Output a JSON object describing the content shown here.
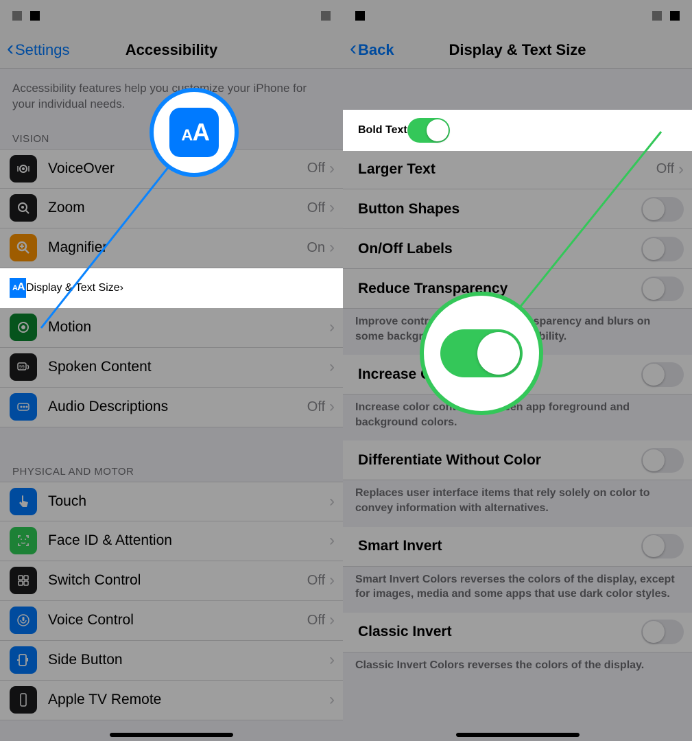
{
  "left": {
    "back": "Settings",
    "title": "Accessibility",
    "intro": "Accessibility features help you customize your iPhone for your individual needs.",
    "sections": {
      "vision_header": "VISION",
      "vision": [
        {
          "label": "VoiceOver",
          "value": "Off",
          "icon": "voiceover",
          "color": "ic-black"
        },
        {
          "label": "Zoom",
          "value": "Off",
          "icon": "zoom",
          "color": "ic-black"
        },
        {
          "label": "Magnifier",
          "value": "On",
          "icon": "magnifier",
          "color": "ic-orange"
        },
        {
          "label": "Display & Text Size",
          "value": "",
          "icon": "textsize",
          "color": "ic-blue",
          "highlight": true
        },
        {
          "label": "Motion",
          "value": "",
          "icon": "motion",
          "color": "ic-green"
        },
        {
          "label": "Spoken Content",
          "value": "",
          "icon": "spoken",
          "color": "ic-black"
        },
        {
          "label": "Audio Descriptions",
          "value": "Off",
          "icon": "audiodesc",
          "color": "ic-blue"
        }
      ],
      "physical_header": "PHYSICAL AND MOTOR",
      "physical": [
        {
          "label": "Touch",
          "value": "",
          "icon": "touch",
          "color": "ic-blue"
        },
        {
          "label": "Face ID & Attention",
          "value": "",
          "icon": "faceid",
          "color": "ic-lgreen"
        },
        {
          "label": "Switch Control",
          "value": "Off",
          "icon": "switch",
          "color": "ic-black"
        },
        {
          "label": "Voice Control",
          "value": "Off",
          "icon": "voicectl",
          "color": "ic-blue"
        },
        {
          "label": "Side Button",
          "value": "",
          "icon": "sidebutton",
          "color": "ic-blue"
        },
        {
          "label": "Apple TV Remote",
          "value": "",
          "icon": "remote",
          "color": "ic-black"
        }
      ]
    },
    "callout_icon": "textsize"
  },
  "right": {
    "back": "Back",
    "title": "Display & Text Size",
    "rows": [
      {
        "label": "Bold Text",
        "type": "toggle",
        "on": true,
        "highlight": true
      },
      {
        "label": "Larger Text",
        "type": "link",
        "value": "Off"
      },
      {
        "label": "Button Shapes",
        "type": "toggle",
        "on": false
      },
      {
        "label": "On/Off Labels",
        "type": "toggle",
        "on": false
      },
      {
        "label": "Reduce Transparency",
        "type": "toggle",
        "on": false,
        "footer": "Improve contrast by reducing transparency and blurs on some backgrounds to increase legibility."
      },
      {
        "label": "Increase Contrast",
        "type": "toggle",
        "on": false,
        "footer": "Increase color contrast between app foreground and background colors."
      },
      {
        "label": "Differentiate Without Color",
        "type": "toggle",
        "on": false,
        "footer": "Replaces user interface items that rely solely on color to convey information with alternatives."
      },
      {
        "label": "Smart Invert",
        "type": "toggle",
        "on": false,
        "footer": "Smart Invert Colors reverses the colors of the display, except for images, media and some apps that use dark color styles."
      },
      {
        "label": "Classic Invert",
        "type": "toggle",
        "on": false,
        "footer": "Classic Invert Colors reverses the colors of the display."
      }
    ]
  }
}
